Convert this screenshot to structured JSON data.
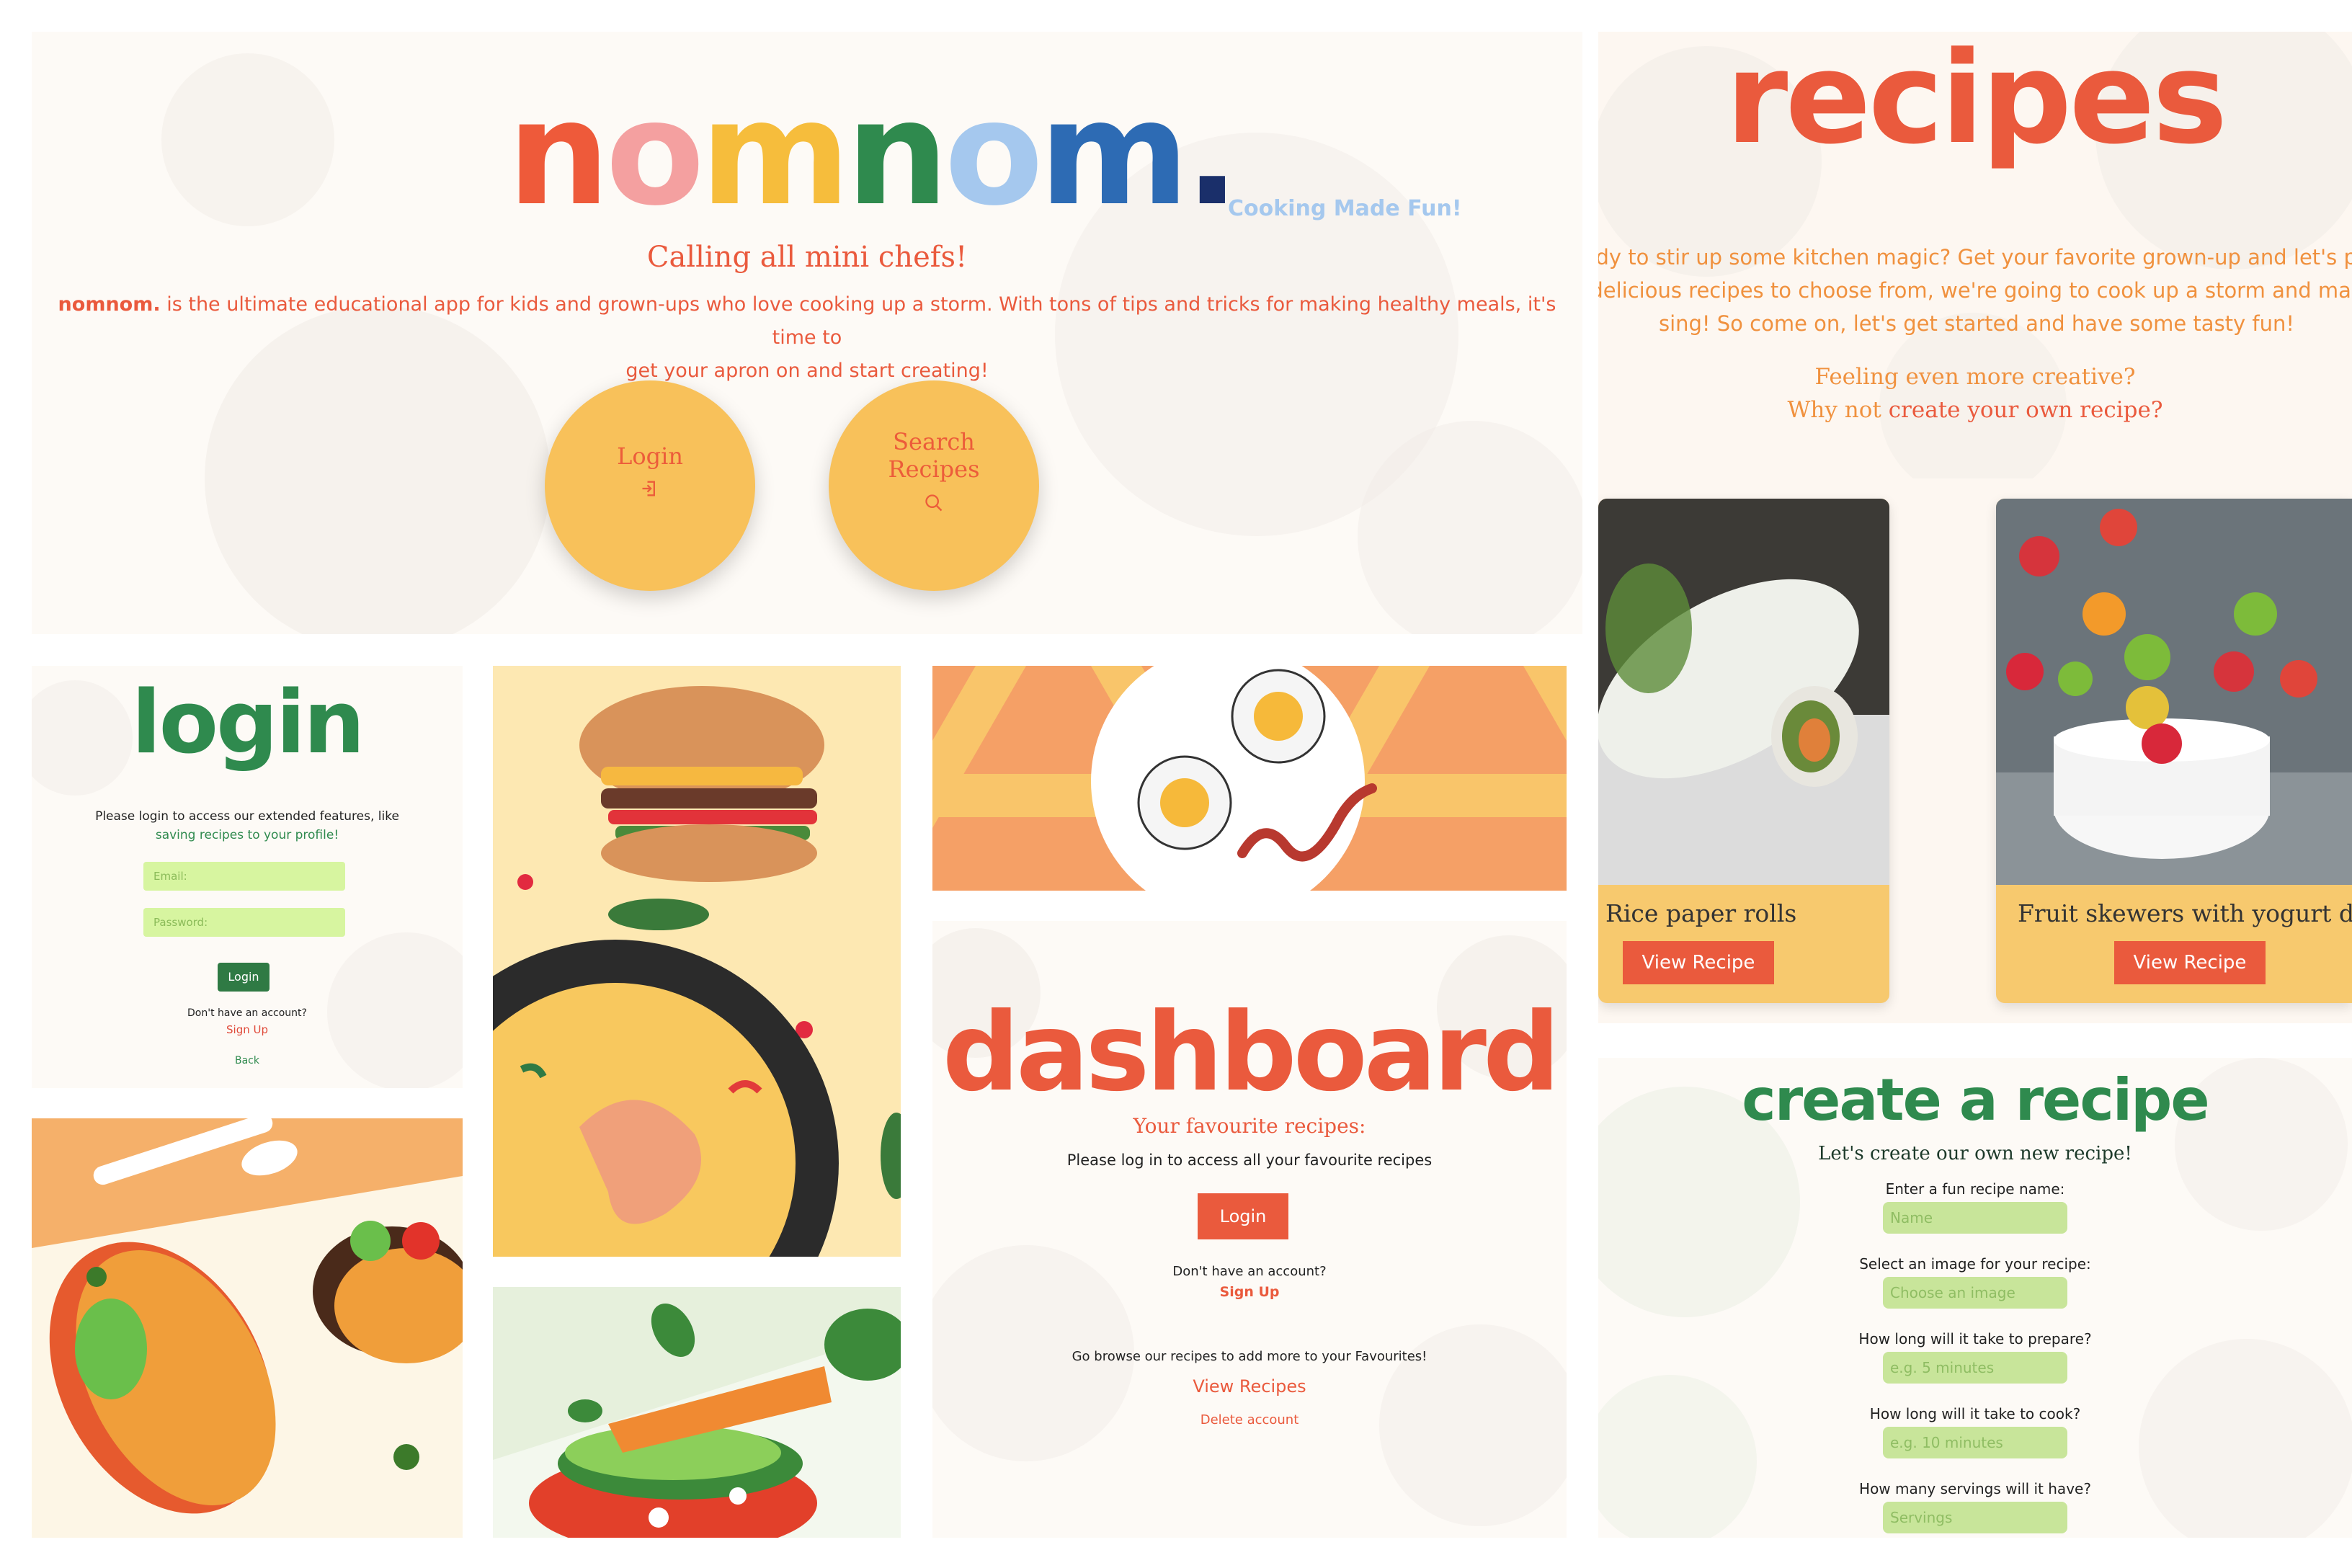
{
  "home": {
    "logo": [
      "n",
      "o",
      "m",
      "n",
      "o",
      "m",
      "."
    ],
    "logo_colors": [
      "#ee5a3a",
      "#f4a0a0",
      "#f6bd3c",
      "#2f8a4e",
      "#a5c8ee",
      "#2d6bb4",
      "#1a2f6a"
    ],
    "tagline": "Cooking Made Fun!",
    "heading": "Calling all mini chefs!",
    "brand_word": "nomnom.",
    "intro_line1": " is the ultimate educational app for kids and grown-ups who love cooking up a storm. With tons of tips and tricks for making healthy meals, it's time to",
    "intro_line2": "get your apron on and start creating!",
    "login_label": "Login",
    "search_label_1": "Search",
    "search_label_2": "Recipes"
  },
  "recipes_page": {
    "title": "recipes",
    "intro_line1": "ady to stir up some kitchen magic? Get your favorite grown-up and let's pu",
    "intro_line2": "delicious recipes to choose from, we're going to cook up a storm and mak",
    "intro_line3": "sing! So come on, let's get started and have some tasty fun!",
    "creative_line1": "Feeling even more creative?",
    "creative_line2_a": "Why not ",
    "creative_line2_b": "create your own recipe?",
    "cards": [
      {
        "name": "Rice paper rolls",
        "button": "View Recipe"
      },
      {
        "name": "Fruit skewers with yogurt d",
        "button": "View Recipe"
      }
    ]
  },
  "login_page": {
    "title": "login",
    "message_line1": "Please login to access our extended features, like",
    "message_line2": "saving recipes to your profile!",
    "email_placeholder": "Email:",
    "password_placeholder": "Password:",
    "login_button": "Login",
    "no_account": "Don't have an account?",
    "signup": "Sign Up",
    "back": "Back"
  },
  "dashboard": {
    "title": "dashboard",
    "subtitle": "Your favourite recipes:",
    "message": "Please log in to access all your favourite recipes",
    "login_button": "Login",
    "no_account": "Don't have an account?",
    "signup": "Sign Up",
    "browse_text": "Go browse our recipes to add more to your Favourites!",
    "view_recipes": "View Recipes",
    "delete_account": "Delete account"
  },
  "create_recipe": {
    "title": "create a recipe",
    "subtitle": "Let's create our own new recipe!",
    "fields": [
      {
        "label": "Enter a fun recipe name:",
        "placeholder": "Name"
      },
      {
        "label": "Select an image for your recipe:",
        "placeholder": "Choose an image"
      },
      {
        "label": "How long will it take to prepare?",
        "placeholder": "e.g. 5 minutes"
      },
      {
        "label": "How long will it take to cook?",
        "placeholder": "e.g. 10 minutes"
      },
      {
        "label": "How many servings will it have?",
        "placeholder": "Servings"
      }
    ]
  },
  "colors": {
    "accent_red": "#ea5a3d",
    "yellow": "#f8c15a",
    "green": "#2f8a4e",
    "field_green": "#d7f5a0"
  },
  "icons": [
    "login-icon",
    "search-icon"
  ]
}
